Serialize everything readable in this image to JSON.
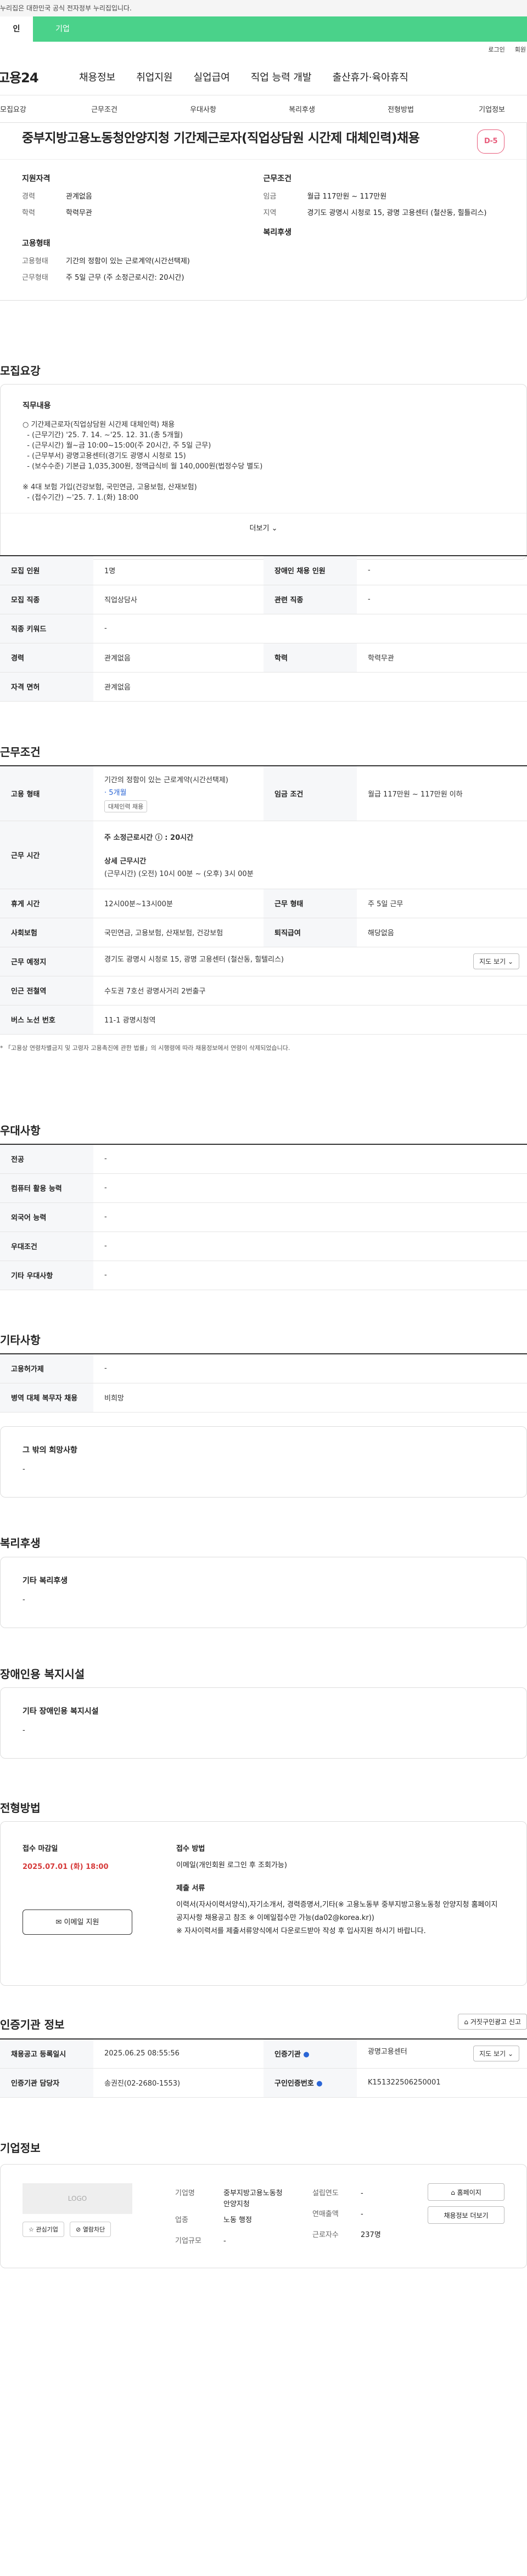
{
  "gov_banner": "누리집은 대한민국 공식 전자정부 누리집입니다.",
  "top_tabs": [
    "인",
    "기업"
  ],
  "util_links": [
    "로그인",
    "회원"
  ],
  "logo": "고용24",
  "gnb": [
    "채용정보",
    "취업지원",
    "실업급여",
    "직업 능력 개발",
    "출산휴가·육아휴직"
  ],
  "subnav": [
    "모집요강",
    "근무조건",
    "우대사항",
    "복리후생",
    "전형방법",
    "기업정보"
  ],
  "job": {
    "title": "중부지방고용노동청안양지청 기간제근로자(직업상담원 시간제 대체인력)채용",
    "dday": "D-5"
  },
  "summary": {
    "qual_heading": "지원자격",
    "qual": [
      {
        "k": "경력",
        "v": "관계없음"
      },
      {
        "k": "학력",
        "v": "학력무관"
      }
    ],
    "cond_heading": "근무조건",
    "cond": [
      {
        "k": "임금",
        "v": "월급 117만원 ~ 117만원"
      },
      {
        "k": "지역",
        "v": "경기도 광명시 시청로 15, 광명 고용센터 (철산동, 힐틀리스)"
      }
    ],
    "form_heading": "고용형태",
    "form": [
      {
        "k": "고용형태",
        "v": "기간의 정함이 있는 근로계약(시간선택제)"
      },
      {
        "k": "근무형태",
        "v": "주 5일 근무 (주 소정근로시간: 20시간)"
      }
    ],
    "welfare_heading": "복리후생"
  },
  "recruit": {
    "title": "모집요강",
    "duty_heading": "직무내용",
    "duty_text": "○ 기간제근로자(직업상담원 시간제 대체인력) 채용\n  - (근무기간) '25. 7. 14. ~'25. 12. 31.(총 5개월)\n  - (근무시간) 월~금 10:00~15:00(주 20시간, 주 5일 근무)\n  - (근무부서) 광명고용센터(경기도 광명시 시청로 15)\n  - (보수수준) 기본급 1,035,300원, 정액급식비 월 140,000원(법정수당 별도)\n\n※ 4대 보험 가입(건강보험, 국민연금, 고용보험, 산재보험)\n  - (접수기간) ~'25. 7. 1.(화) 18:00",
    "more": "더보기",
    "rows": [
      {
        "k1": "모집 인원",
        "v1": "1명",
        "k2": "장애인 채용 인원",
        "v2": "-"
      },
      {
        "k1": "모집 직종",
        "v1": "직업상담사",
        "k2": "관련 직종",
        "v2": "-"
      },
      {
        "k1": "직종 키워드",
        "v1": "-"
      },
      {
        "k1": "경력",
        "v1": "관계없음",
        "k2": "학력",
        "v2": "학력무관"
      },
      {
        "k1": "자격 면허",
        "v1": "관계없음"
      }
    ]
  },
  "conditions": {
    "title": "근무조건",
    "emp_form_k": "고용 형태",
    "emp_form_v": "기간의 정함이 있는 근로계약(시간선택제)",
    "emp_form_months": "· 5개월",
    "emp_form_tag": "대체인력 채용",
    "wage_k": "임금 조건",
    "wage_v": "월급 117만원 ~ 117만원 이하",
    "hours_k": "근무 시간",
    "hours_v1": "주 소정근로시간 ⓘ : 20시간",
    "hours_v2_h": "상세 근무시간",
    "hours_v2": "(근무시간) (오전) 10시 00분 ~ (오후) 3시 00분",
    "break_k": "휴게 시간",
    "break_v": "12시00분~13시00분",
    "shift_k": "근무 형태",
    "shift_v": "주 5일 근무",
    "ins_k": "사회보험",
    "ins_v": "국민연금, 고용보험, 산재보험, 건강보험",
    "sev_k": "퇴직급여",
    "sev_v": "해당없음",
    "loc_k": "근무 예정지",
    "loc_v": "경기도 광명시 시청로 15, 광명 고용센터 (철산동, 힐텔리스)",
    "map_btn": "지도 보기",
    "subway_k": "인근 전철역",
    "subway_v": "수도권 7호선 광명사거리 2번출구",
    "bus_k": "버스 노선 번호",
    "bus_v": "11-1 광명시청역",
    "note": "* 「고용상 연령차별금지 및 고령자 고용촉진에 관한 법률」의 시행령에 따라 채용정보에서 연령이 삭제되었습니다."
  },
  "pref": {
    "title": "우대사항",
    "rows": [
      {
        "k": "전공",
        "v": "-"
      },
      {
        "k": "컴퓨터 활용 능력",
        "v": "-"
      },
      {
        "k": "외국어 능력",
        "v": "-"
      },
      {
        "k": "우대조건",
        "v": "-"
      },
      {
        "k": "기타 우대사항",
        "v": "-"
      }
    ]
  },
  "etc": {
    "title": "기타사항",
    "rows": [
      {
        "k": "고용허가제",
        "v": "-"
      },
      {
        "k": "병역 대체 복무자 채용",
        "v": "비희망"
      }
    ],
    "other_h": "그 밖의 희망사항",
    "other_v": "-"
  },
  "welfare": {
    "title": "복리후생",
    "h": "기타 복리후생",
    "v": "-"
  },
  "disability": {
    "title": "장애인용 복지시설",
    "h": "기타 장애인용 복지시설",
    "v": "-"
  },
  "apply": {
    "title": "전형방법",
    "deadline_h": "접수 마감일",
    "deadline_v": "2025.07.01 (화) 18:00",
    "method_h": "접수 방법",
    "method_v": "이메일(개인회원 로그인 후 조회가능)",
    "docs_h": "제출 서류",
    "docs_v": "이력서(자사이력서양식),자기소개서, 경력증명서,기타(※ 고용노동부 중부지방고용노동청 안양지청 홈페이지 공지사항 채용공고 참조 ※ 이메일접수만 가능(da02@korea.kr))\n※ 자사이력서를 제출서류양식에서 다운로드받아 작성 후 입사지원 하시기 바랍니다.",
    "btn": "이메일 지원"
  },
  "cert": {
    "title": "인증기관 정보",
    "report_btn": "거짓구인광고 신고",
    "reg_k": "채용공고 등록일시",
    "reg_v": "2025.06.25 08:55:56",
    "org_k": "인증기관",
    "org_v": "광명고용센터",
    "map_btn": "지도 보기",
    "mgr_k": "인증기관 담당자",
    "mgr_v": "송권진(02-2680-1553)",
    "id_k": "구인인증번호",
    "id_v": "K151322506250001"
  },
  "corp": {
    "title": "기업정보",
    "logo": "LOGO",
    "fav_btn": "관심기업",
    "watch_btn": "열람차단",
    "name_k": "기업명",
    "name_v": "중부지방고용노동청 안양지청",
    "ind_k": "업종",
    "ind_v": "노동 행정",
    "size_k": "기업규모",
    "size_v": "-",
    "est_k": "설립연도",
    "est_v": "-",
    "rev_k": "연매출액",
    "rev_v": "-",
    "emp_k": "근로자수",
    "emp_v": "237명",
    "home_btn": "홈페이지",
    "jobs_btn": "채용정보 더보기"
  }
}
